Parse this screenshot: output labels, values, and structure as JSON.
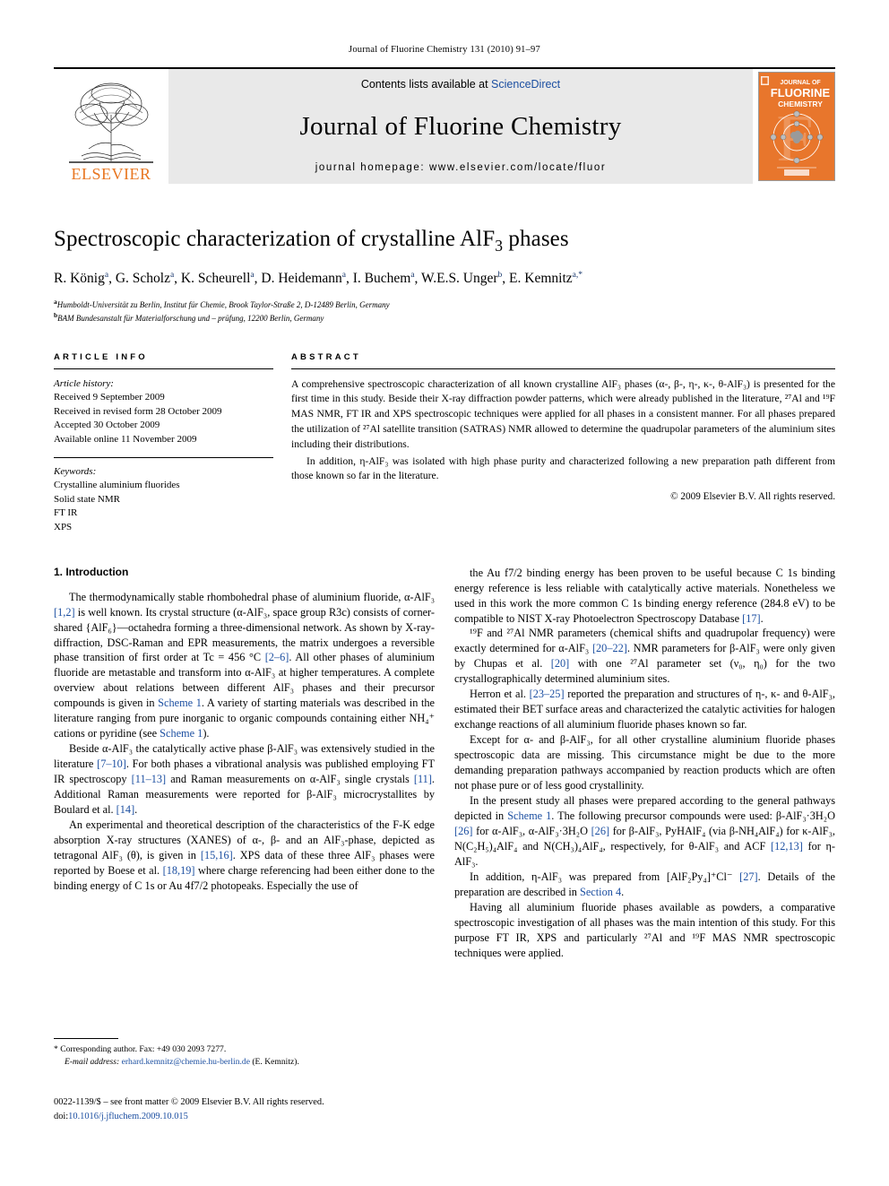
{
  "running_head": "Journal of Fluorine Chemistry 131 (2010) 91–97",
  "masthead": {
    "publisher_name": "ELSEVIER",
    "contents_prefix": "Contents lists available at ",
    "contents_link": "ScienceDirect",
    "journal_title": "Journal of Fluorine Chemistry",
    "homepage": "journal homepage: www.elsevier.com/locate/fluor",
    "cover": {
      "line1": "JOURNAL OF",
      "line2": "FLUORINE",
      "line3": "CHEMISTRY",
      "bg_color": "#E8762C"
    }
  },
  "article": {
    "title_part1": "Spectroscopic characterization of crystalline AlF",
    "title_sub": "3",
    "title_part2": " phases",
    "authors": [
      {
        "name": "R. König",
        "sup": "a"
      },
      {
        "name": "G. Scholz",
        "sup": "a"
      },
      {
        "name": "K. Scheurell",
        "sup": "a"
      },
      {
        "name": "D. Heidemann",
        "sup": "a"
      },
      {
        "name": "I. Buchem",
        "sup": "a"
      },
      {
        "name": "W.E.S. Unger",
        "sup": "b"
      },
      {
        "name": "E. Kemnitz",
        "sup": "a,*"
      }
    ],
    "affiliations": [
      {
        "marker": "a",
        "text": "Humboldt-Universität zu Berlin, Institut für Chemie, Brook Taylor-Straße 2, D-12489 Berlin, Germany"
      },
      {
        "marker": "b",
        "text": "BAM Bundesanstalt für Materialforschung und – prüfung, 12200 Berlin, Germany"
      }
    ]
  },
  "article_info": {
    "heading": "ARTICLE INFO",
    "history_label": "Article history:",
    "history": [
      "Received 9 September 2009",
      "Received in revised form 28 October 2009",
      "Accepted 30 October 2009",
      "Available online 11 November 2009"
    ],
    "keywords_label": "Keywords:",
    "keywords": [
      "Crystalline aluminium fluorides",
      "Solid state NMR",
      "FT IR",
      "XPS"
    ]
  },
  "abstract": {
    "heading": "ABSTRACT",
    "paragraph1": "A comprehensive spectroscopic characterization of all known crystalline AlF₃ phases (α-, β-, η-, κ-, θ-AlF₃) is presented for the first time in this study. Beside their X-ray diffraction powder patterns, which were already published in the literature, ²⁷Al and ¹⁹F MAS NMR, FT IR and XPS spectroscopic techniques were applied for all phases in a consistent manner. For all phases prepared the utilization of ²⁷Al satellite transition (SATRAS) NMR allowed to determine the quadrupolar parameters of the aluminium sites including their distributions.",
    "paragraph2": "In addition, η-AlF₃ was isolated with high phase purity and characterized following a new preparation path different from those known so far in the literature.",
    "copyright": "© 2009 Elsevier B.V. All rights reserved."
  },
  "body": {
    "section_heading": "1. Introduction",
    "left_paragraphs": [
      "The thermodynamically stable rhombohedral phase of aluminium fluoride, α-AlF₃ [1,2] is well known. Its crystal structure (α-AlF₃, space group R3c) consists of corner-shared {AlF₆}—octahedra forming a three-dimensional network. As shown by X-ray-diffraction, DSC-Raman and EPR measurements, the matrix undergoes a reversible phase transition of first order at Tc = 456 °C [2–6]. All other phases of aluminium fluoride are metastable and transform into α-AlF₃ at higher temperatures. A complete overview about relations between different AlF₃ phases and their precursor compounds is given in Scheme 1. A variety of starting materials was described in the literature ranging from pure inorganic to organic compounds containing either NH₄⁺ cations or pyridine (see Scheme 1).",
      "Beside α-AlF₃ the catalytically active phase β-AlF₃ was extensively studied in the literature [7–10]. For both phases a vibrational analysis was published employing FT IR spectroscopy [11–13] and Raman measurements on α-AlF₃ single crystals [11]. Additional Raman measurements were reported for β-AlF₃ microcrystallites by Boulard et al. [14].",
      "An experimental and theoretical description of the characteristics of the F-K edge absorption X-ray structures (XANES) of α-, β- and an AlF₃-phase, depicted as tetragonal AlF₃ (θ), is given in [15,16]. XPS data of these three AlF₃ phases were reported by Boese et al. [18,19] where charge referencing had been either done to the binding energy of C 1s or Au 4f7/2 photopeaks. Especially the use of"
    ],
    "right_paragraphs": [
      "the Au f7/2 binding energy has been proven to be useful because C 1s binding energy reference is less reliable with catalytically active materials. Nonetheless we used in this work the more common C 1s binding energy reference (284.8 eV) to be compatible to NIST X-ray Photoelectron Spectroscopy Database [17].",
      "¹⁹F and ²⁷Al NMR parameters (chemical shifts and quadrupolar frequency) were exactly determined for α-AlF₃ [20–22]. NMR parameters for β-AlF₃ were only given by Chupas et al. [20] with one ²⁷Al parameter set (ν₀, η₀) for the two crystallographically determined aluminium sites.",
      "Herron et al. [23–25] reported the preparation and structures of η-, κ- and θ-AlF₃, estimated their BET surface areas and characterized the catalytic activities for halogen exchange reactions of all aluminium fluoride phases known so far.",
      "Except for α- and β-AlF₃, for all other crystalline aluminium fluoride phases spectroscopic data are missing. This circumstance might be due to the more demanding preparation pathways accompanied by reaction products which are often not phase pure or of less good crystallinity.",
      "In the present study all phases were prepared according to the general pathways depicted in Scheme 1. The following precursor compounds were used: β-AlF₃·3H₂O [26] for α-AlF₃, α-AlF₃·3H₂O [26] for β-AlF₃, PyHAlF₄ (via β-NH₄AlF₄) for κ-AlF₃, N(C₂H₅)₄AlF₄ and N(CH₃)₄AlF₄, respectively, for θ-AlF₃ and ACF [12,13] for η-AlF₃.",
      "In addition, η-AlF₃ was prepared from [AlF₂Py₄]⁺Cl⁻ [27]. Details of the preparation are described in Section 4.",
      "Having all aluminium fluoride phases available as powders, a comparative spectroscopic investigation of all phases was the main intention of this study. For this purpose FT IR, XPS and particularly ²⁷Al and ¹⁹F MAS NMR spectroscopic techniques were applied."
    ]
  },
  "footnotes": {
    "corresponding": "* Corresponding author. Fax: +49 030 2093 7277.",
    "email_label": "E-mail address:",
    "email": "erhard.kemnitz@chemie.hu-berlin.de",
    "email_suffix": " (E. Kemnitz).",
    "issn_line": "0022-1139/$ – see front matter © 2009 Elsevier B.V. All rights reserved.",
    "doi_label": "doi:",
    "doi": "10.1016/j.jfluchem.2009.10.015"
  },
  "colors": {
    "link": "#1c4fa1",
    "elsevier_orange": "#E87722"
  }
}
